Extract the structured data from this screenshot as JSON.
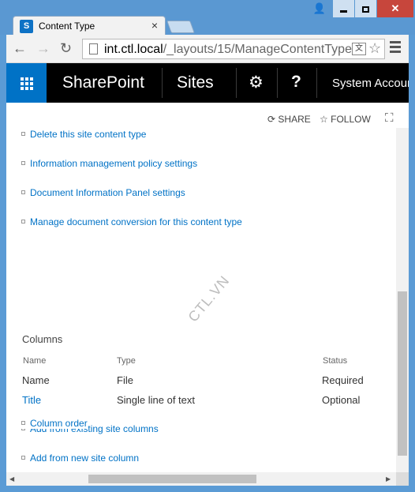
{
  "browser": {
    "tab_title": "Content Type",
    "tab_close": "×",
    "url_host": "int.ctl.local",
    "url_path": "/_layouts/15/ManageContentType",
    "nav_back": "←",
    "nav_forward": "→",
    "nav_reload": "↻",
    "translate_glyph": "文",
    "star_glyph": "☆"
  },
  "window": {
    "user_glyph": "👤",
    "close_glyph": "✕"
  },
  "suitebar": {
    "brand": "SharePoint",
    "sites": "Sites",
    "settings_glyph": "⚙",
    "help_glyph": "?",
    "account": "System Account",
    "accent": "#0072c6"
  },
  "actions": {
    "share": "SHARE",
    "follow": "FOLLOW",
    "share_glyph": "⟳",
    "follow_glyph": "☆",
    "focus_glyph": "⛶"
  },
  "settings_links": [
    "Delete this site content type",
    "Information management policy settings",
    "Document Information Panel settings",
    "Manage document conversion for this content type"
  ],
  "columns": {
    "title": "Columns",
    "headers": {
      "name": "Name",
      "type": "Type",
      "status": "Status"
    },
    "rows": [
      {
        "name": "Name",
        "type": "File",
        "status": "Required"
      },
      {
        "name": "Title",
        "type": "Single line of text",
        "status": "Optional"
      }
    ]
  },
  "column_links": [
    "Add from existing site columns",
    "Add from new site column",
    "Column order"
  ],
  "watermark": "CTL.VN"
}
